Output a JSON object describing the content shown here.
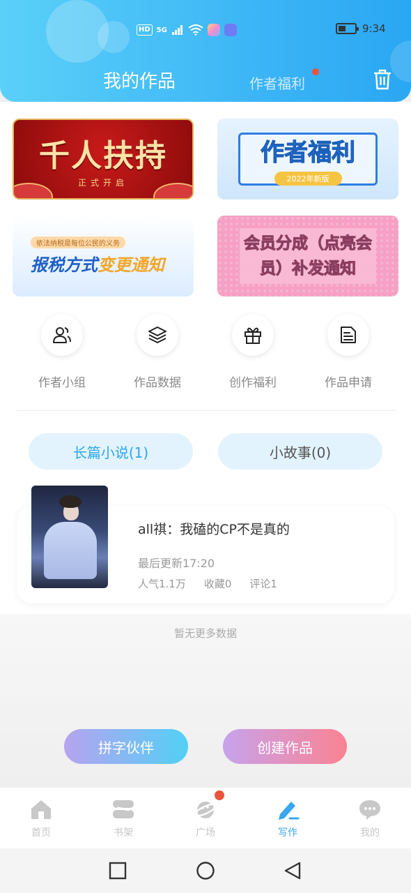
{
  "status_bar": {
    "network_badge": "HD",
    "signal_label": "5G",
    "time": "9:34",
    "battery_icon": "battery-icon"
  },
  "header": {
    "active_tab": "我的作品",
    "inactive_tab": "作者福利",
    "has_notification_dot": true,
    "trash_icon": "trash-icon"
  },
  "banners": [
    {
      "title": "千人扶持",
      "subtitle": "正式开启"
    },
    {
      "title": "作者福利",
      "subtitle": "2022年新版"
    },
    {
      "tag": "依法纳税是每位公民的义务",
      "title_a": "报税方式",
      "title_b": "变更通知"
    },
    {
      "title_line1": "会员分成（点亮会",
      "title_line2": "员）补发通知"
    }
  ],
  "quick_actions": [
    {
      "label": "作者小组",
      "icon": "users-icon"
    },
    {
      "label": "作品数据",
      "icon": "layers-icon"
    },
    {
      "label": "创作福利",
      "icon": "gift-icon"
    },
    {
      "label": "作品申请",
      "icon": "document-icon"
    }
  ],
  "segments": {
    "long_novel": "长篇小说(1)",
    "short_story": "小故事(0)"
  },
  "works": [
    {
      "title": "all祺：我磕的CP不是真的",
      "updated": "最后更新17:20",
      "popularity": "人气1.1万",
      "favorites": "收藏0",
      "comments": "评论1"
    }
  ],
  "empty_hint": "暂无更多数据",
  "actions": {
    "find_partner": "拼字伙伴",
    "create_work": "创建作品"
  },
  "bottom_nav": [
    {
      "label": "首页",
      "icon": "home-icon"
    },
    {
      "label": "书架",
      "icon": "bookshelf-icon"
    },
    {
      "label": "广场",
      "icon": "planet-icon"
    },
    {
      "label": "写作",
      "icon": "pen-icon"
    },
    {
      "label": "我的",
      "icon": "chat-bubble-icon"
    }
  ],
  "colors": {
    "accent": "#3aa6ef",
    "header_gradient_start": "#5ad0f8",
    "header_gradient_end": "#2aa7f3",
    "notification": "#e8553a"
  }
}
